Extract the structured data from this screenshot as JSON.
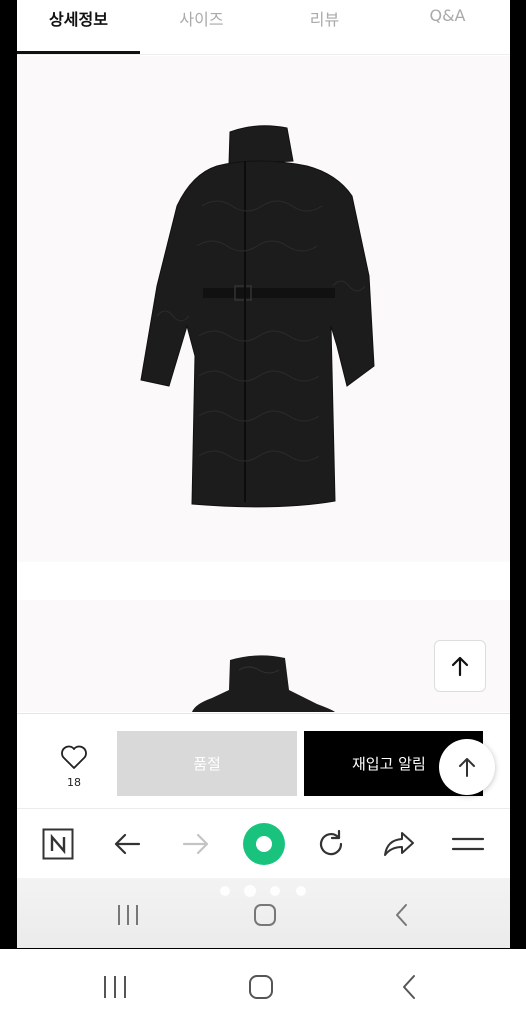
{
  "tabs": [
    {
      "label": "상세정보",
      "active": true
    },
    {
      "label": "사이즈",
      "active": false
    },
    {
      "label": "리뷰",
      "active": false
    },
    {
      "label": "Q&A",
      "active": false
    }
  ],
  "product": {
    "image_description_icon": "black-quilted-long-coat-image"
  },
  "buy_bar": {
    "like_count": "18",
    "soldout_label": "품절",
    "restock_label": "재입고 알림"
  },
  "toolbar": {
    "icons": [
      "n-logo-icon",
      "back-arrow-icon",
      "forward-arrow-icon",
      "home-ring-icon",
      "refresh-icon",
      "share-icon",
      "menu-icon"
    ]
  },
  "system_nav": {
    "icons": [
      "recent-apps-icon",
      "home-icon",
      "back-icon"
    ]
  },
  "colors": {
    "accent_green": "#19c37d",
    "black": "#000000",
    "soldout_gray": "#d9d9d9"
  }
}
